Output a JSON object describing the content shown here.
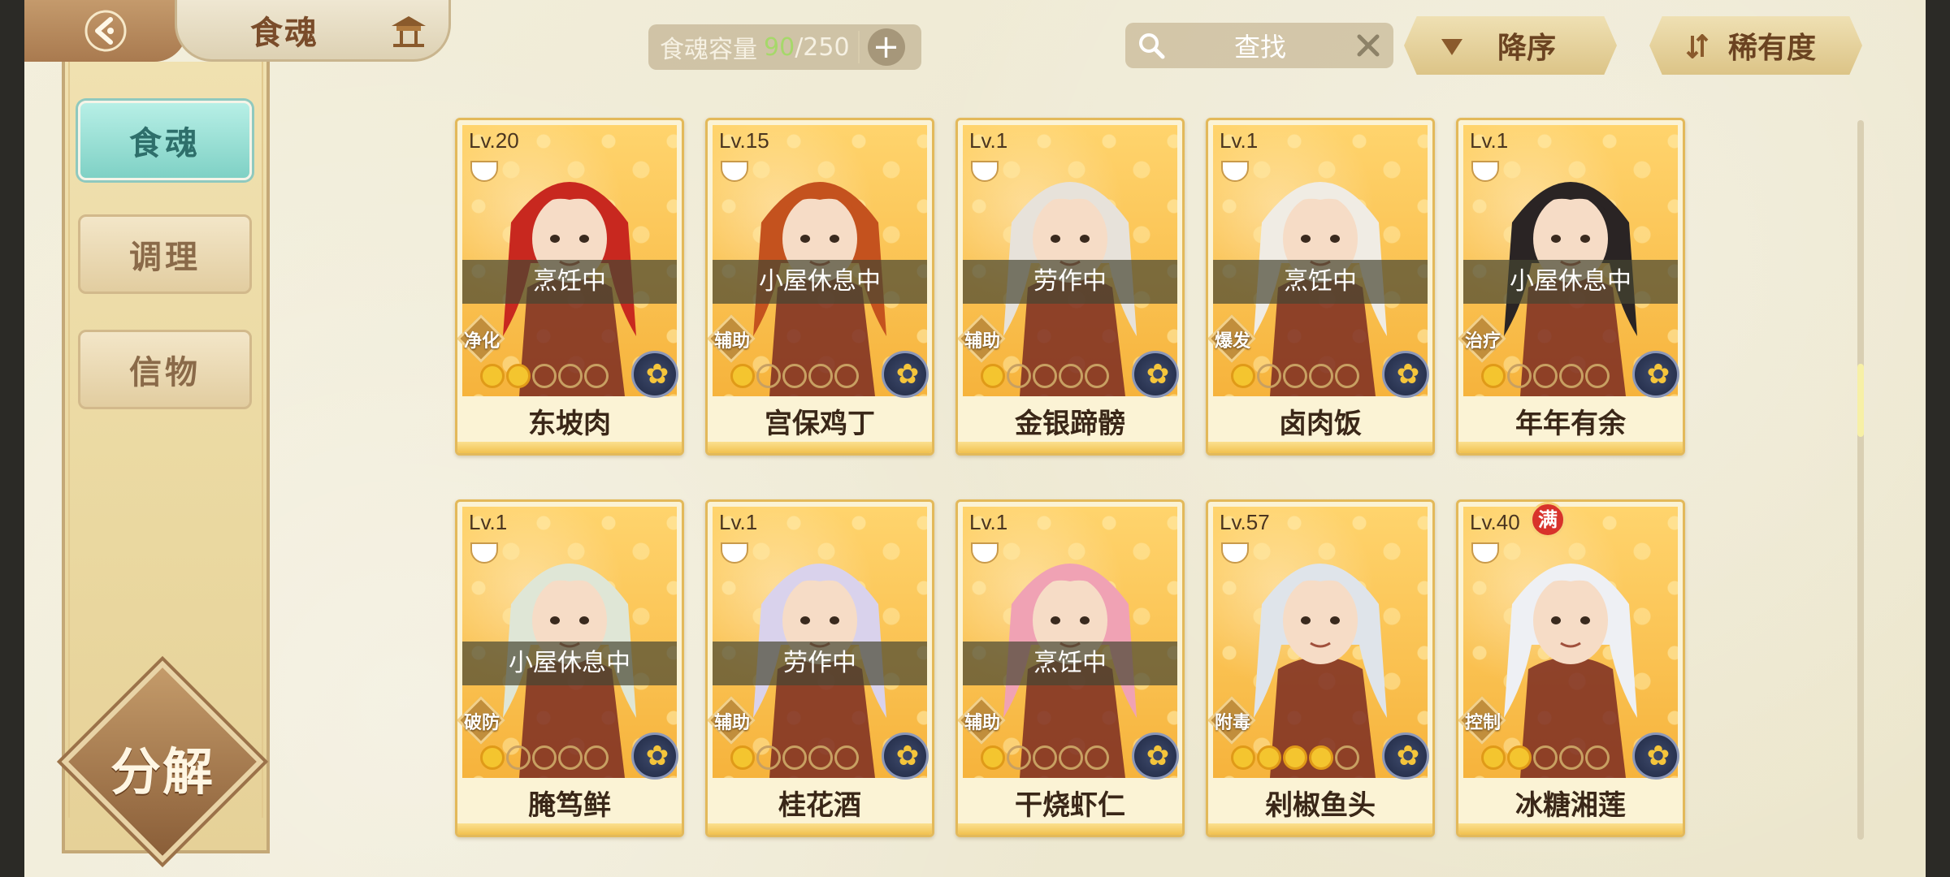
{
  "header": {
    "title": "食魂",
    "capacity_label": "食魂容量",
    "capacity_current": "90",
    "capacity_max": "/250",
    "search_label": "查找",
    "sort_order_label": "降序",
    "sort_by_label": "稀有度"
  },
  "sidebar": {
    "items": [
      {
        "label": "食魂",
        "active": true
      },
      {
        "label": "调理",
        "active": false
      },
      {
        "label": "信物",
        "active": false
      }
    ],
    "decompose_label": "分解"
  },
  "cards": [
    {
      "level": "Lv.20",
      "status": "烹饪中",
      "role": "净化",
      "stars": 2,
      "name": "东坡肉",
      "hair": "#c8281f",
      "max": false
    },
    {
      "level": "Lv.15",
      "status": "小屋休息中",
      "role": "辅助",
      "stars": 1,
      "name": "宫保鸡丁",
      "hair": "#c4521e",
      "max": false
    },
    {
      "level": "Lv.1",
      "status": "劳作中",
      "role": "辅助",
      "stars": 1,
      "name": "金银蹄髈",
      "hair": "#e7e2da",
      "max": false
    },
    {
      "level": "Lv.1",
      "status": "烹饪中",
      "role": "爆发",
      "stars": 1,
      "name": "卤肉饭",
      "hair": "#f0ece4",
      "max": false
    },
    {
      "level": "Lv.1",
      "status": "小屋休息中",
      "role": "治疗",
      "stars": 1,
      "name": "年年有余",
      "hair": "#2a2424",
      "max": false
    },
    {
      "level": "Lv.1",
      "status": "小屋休息中",
      "role": "破防",
      "stars": 1,
      "name": "腌笃鲜",
      "hair": "#dfe6d6",
      "max": false
    },
    {
      "level": "Lv.1",
      "status": "劳作中",
      "role": "辅助",
      "stars": 1,
      "name": "桂花酒",
      "hair": "#d9d2ec",
      "max": false
    },
    {
      "level": "Lv.1",
      "status": "烹饪中",
      "role": "辅助",
      "stars": 1,
      "name": "干烧虾仁",
      "hair": "#f0a2b4",
      "max": false
    },
    {
      "level": "Lv.57",
      "status": "",
      "role": "附毒",
      "stars": 4,
      "name": "剁椒鱼头",
      "hair": "#dfe4ea",
      "max": false
    },
    {
      "level": "Lv.40",
      "status": "",
      "role": "控制",
      "stars": 2,
      "name": "冰糖湘莲",
      "hair": "#eef0f4",
      "max": true,
      "max_label": "满"
    }
  ],
  "colors": {
    "accent_teal": "#7fd1c5",
    "gold": "#f4c52f",
    "brown": "#7a4c2a"
  }
}
